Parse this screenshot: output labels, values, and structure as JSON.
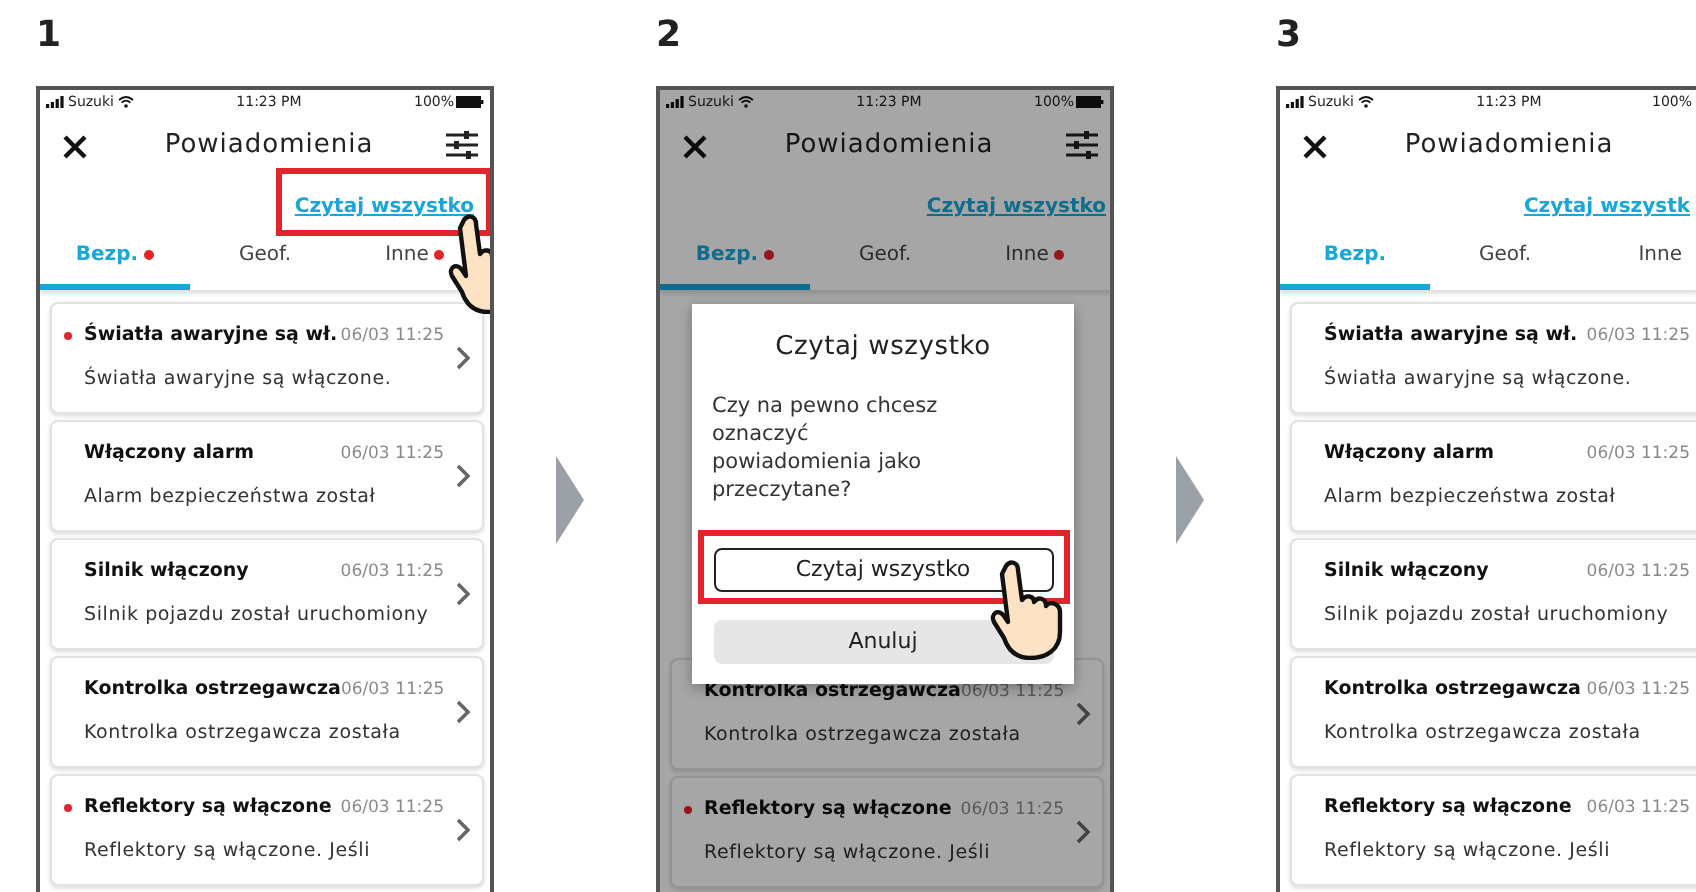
{
  "steps": [
    {
      "number": "1",
      "cut_right": false,
      "dimmed": false,
      "status": {
        "carrier": "Suzuki",
        "time": "11:23 PM",
        "battery": "100%"
      },
      "title": "Powiadomienia",
      "read_all": {
        "label": "Czytaj wszystko",
        "highlighted": true,
        "tapped": true
      },
      "tabs": [
        {
          "label": "Bezp.",
          "selected": true,
          "unread": true
        },
        {
          "label": "Geof.",
          "selected": false,
          "unread": false
        },
        {
          "label": "Inne",
          "selected": false,
          "unread": true
        }
      ],
      "notifications": [
        {
          "title": "Światła awaryjne są wł.",
          "time": "06/03 11:25",
          "body": "Światła awaryjne są włączone.",
          "unread": true
        },
        {
          "title": "Włączony alarm",
          "time": "06/03 11:25",
          "body": "Alarm bezpieczeństwa został",
          "unread": false
        },
        {
          "title": "Silnik włączony",
          "time": "06/03 11:25",
          "body": "Silnik pojazdu został uruchomiony",
          "unread": false
        },
        {
          "title": "Kontrolka ostrzegawcza",
          "time": "06/03 11:25",
          "body": "Kontrolka ostrzegawcza została",
          "unread": false
        },
        {
          "title": "Reflektory są włączone",
          "time": "06/03 11:25",
          "body": "Reflektory są włączone. Jeśli",
          "unread": true
        }
      ]
    },
    {
      "number": "2",
      "cut_right": false,
      "dimmed": true,
      "status": {
        "carrier": "Suzuki",
        "time": "11:23 PM",
        "battery": "100%"
      },
      "title": "Powiadomienia",
      "read_all": {
        "label": "Czytaj wszystko",
        "highlighted": false,
        "tapped": false
      },
      "tabs": [
        {
          "label": "Bezp.",
          "selected": true,
          "unread": true
        },
        {
          "label": "Geof.",
          "selected": false,
          "unread": false
        },
        {
          "label": "Inne",
          "selected": false,
          "unread": true
        }
      ],
      "notifications": [
        {
          "title": "Kontrolka ostrzegawcza",
          "time": "06/03 11:25",
          "body": "Kontrolka ostrzegawcza została",
          "unread": false
        },
        {
          "title": "Reflektory są włączone",
          "time": "06/03 11:25",
          "body": "Reflektory są włączone. Jeśli",
          "unread": true
        }
      ],
      "dialog": {
        "title": "Czytaj wszystko",
        "message": "Czy na pewno chcesz oznaczyć powiadomienia jako przeczytane?",
        "confirm": {
          "label": "Czytaj wszystko",
          "highlighted": true,
          "tapped": true
        },
        "cancel": "Anuluj"
      }
    },
    {
      "number": "3",
      "cut_right": true,
      "dimmed": false,
      "status": {
        "carrier": "Suzuki",
        "time": "11:23 PM",
        "battery": "100%"
      },
      "title": "Powiadomienia",
      "read_all": {
        "label": "Czytaj wszystk",
        "highlighted": false,
        "tapped": false
      },
      "tabs": [
        {
          "label": "Bezp.",
          "selected": true,
          "unread": false
        },
        {
          "label": "Geof.",
          "selected": false,
          "unread": false
        },
        {
          "label": "Inne",
          "selected": false,
          "unread": false
        }
      ],
      "notifications": [
        {
          "title": "Światła awaryjne są wł.",
          "time": "06/03 11:25",
          "body": "Światła awaryjne są włączone.",
          "unread": false
        },
        {
          "title": "Włączony alarm",
          "time": "06/03 11:25",
          "body": "Alarm bezpieczeństwa został",
          "unread": false
        },
        {
          "title": "Silnik włączony",
          "time": "06/03 11:25",
          "body": "Silnik pojazdu został uruchomiony",
          "unread": false
        },
        {
          "title": "Kontrolka ostrzegawcza",
          "time": "06/03 11:25",
          "body": "Kontrolka ostrzegawcza została",
          "unread": false
        },
        {
          "title": "Reflektory są włączone",
          "time": "06/03 11:25",
          "body": "Reflektory są włączone. Jeśli",
          "unread": false
        }
      ]
    }
  ]
}
